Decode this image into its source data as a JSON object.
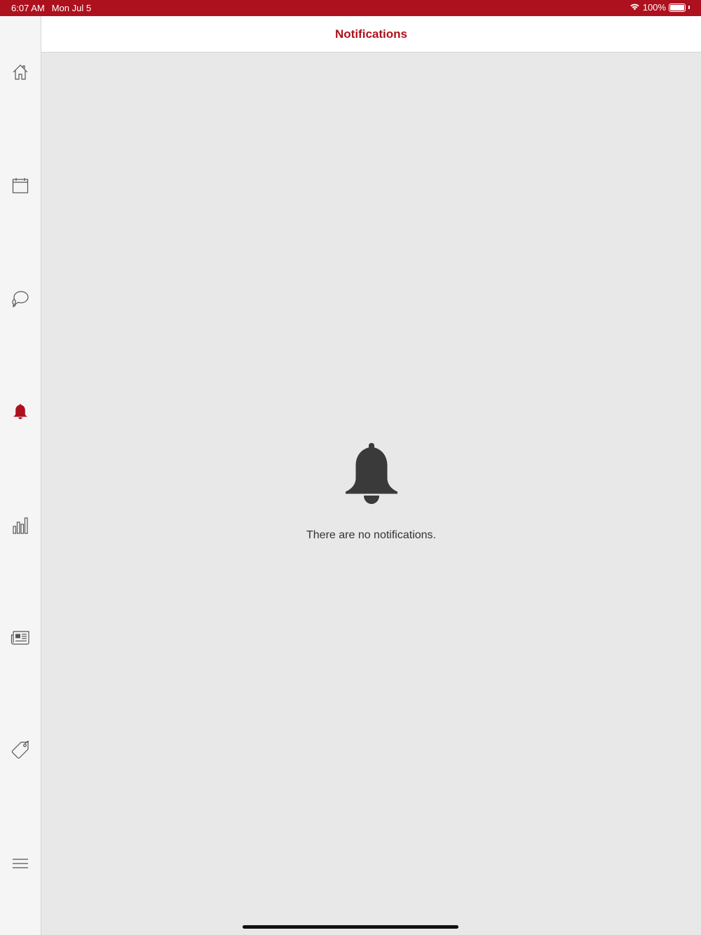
{
  "status_bar": {
    "time": "6:07 AM",
    "date": "Mon Jul 5",
    "battery": "100%",
    "battery_level": 1.0,
    "wifi_icon": "wifi-icon"
  },
  "header": {
    "title": "Notifications"
  },
  "sidebar": {
    "items": [
      {
        "icon": "home-icon",
        "active": false
      },
      {
        "icon": "calendar-icon",
        "active": false
      },
      {
        "icon": "chat-icon",
        "active": false
      },
      {
        "icon": "bell-icon",
        "active": true
      },
      {
        "icon": "bar-chart-icon",
        "active": false
      },
      {
        "icon": "newspaper-icon",
        "active": false
      },
      {
        "icon": "tag-icon",
        "active": false
      },
      {
        "icon": "menu-icon",
        "active": false
      }
    ]
  },
  "empty_state": {
    "icon": "bell-icon",
    "message": "There are no notifications."
  },
  "colors": {
    "accent": "#ad111e",
    "icon_inactive": "#555555",
    "background": "#e8e8e8",
    "sidebar_bg": "#f5f5f5"
  }
}
